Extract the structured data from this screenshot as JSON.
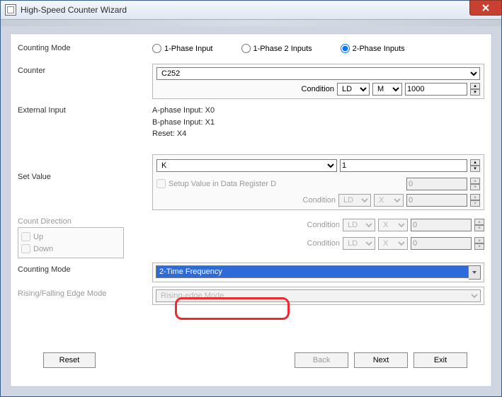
{
  "title": "High-Speed Counter Wizard",
  "labels": {
    "counting_mode_top": "Counting Mode",
    "counter": "Counter",
    "ext_input": "External Input",
    "set_value": "Set Value",
    "count_dir": "Count Direction",
    "counting_mode_bot": "Counting Mode",
    "edge_mode": "Rising/Falling Edge Mode",
    "condition": "Condition",
    "setup_dr": "Setup Value in Data Register D",
    "up": "Up",
    "down": "Down"
  },
  "radios": {
    "p1": "1-Phase Input",
    "p12": "1-Phase 2 Inputs",
    "p2": "2-Phase Inputs"
  },
  "counter": {
    "value": "C252",
    "cond_op": "LD",
    "cond_dev": "M",
    "cond_num": "1000"
  },
  "ext": {
    "a": "A-phase Input: X0",
    "b": "B-phase Input: X1",
    "r": "Reset: X4"
  },
  "setv": {
    "type": "K",
    "num": "1",
    "dr_val": "0",
    "cond_op": "LD",
    "cond_dev": "X",
    "cond_num": "0"
  },
  "dir": {
    "c1": {
      "op": "LD",
      "dev": "X",
      "num": "0"
    },
    "c2": {
      "op": "LD",
      "dev": "X",
      "num": "0"
    }
  },
  "cm_sel": "2-Time Frequency",
  "edge_sel": "Rising-edge Mode",
  "buttons": {
    "reset": "Reset",
    "back": "Back",
    "next": "Next",
    "exit": "Exit"
  }
}
